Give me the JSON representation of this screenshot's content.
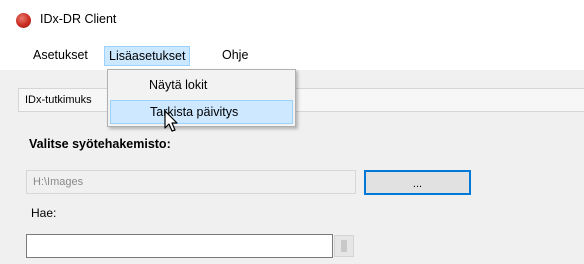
{
  "window": {
    "title": "IDx-DR Client"
  },
  "menubar": {
    "items": [
      {
        "label": "Asetukset"
      },
      {
        "label": "Lisäasetukset"
      },
      {
        "label": "Ohje"
      }
    ]
  },
  "dropdown": {
    "items": [
      {
        "label": "Näytä lokit"
      },
      {
        "label": "Tarkista päivitys"
      }
    ]
  },
  "tabs": {
    "active_label": "IDx-tutkimuks"
  },
  "form": {
    "section_label": "Valitse syötehakemisto:",
    "directory_value": "H:\\Images",
    "browse_label": "...",
    "search_label": "Hae:",
    "search_value": ""
  },
  "icons": {
    "app": "app-icon",
    "cursor": "pointer-cursor"
  }
}
